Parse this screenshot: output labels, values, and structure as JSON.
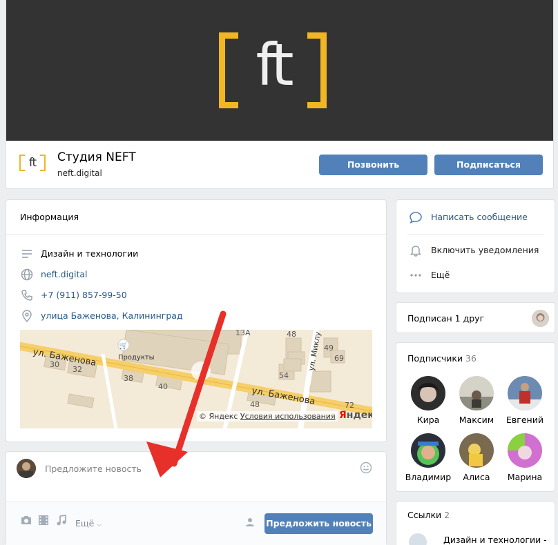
{
  "header": {
    "logo_text": "ft",
    "group_name": "Студия NEFT",
    "group_link": "neft.digital",
    "call_button": "Позвонить",
    "subscribe_button": "Подписаться"
  },
  "info": {
    "title": "Информация",
    "rows": [
      {
        "icon": "list-icon",
        "text": "Дизайн и технологии",
        "link": false
      },
      {
        "icon": "globe-icon",
        "text": "neft.digital",
        "link": true
      },
      {
        "icon": "phone-icon",
        "text": "+7 (911) 857-99-50",
        "link": true
      },
      {
        "icon": "location-pin-icon",
        "text": "улица Баженова, Калининград",
        "link": true
      }
    ],
    "map": {
      "street_label_1": "ул. Баженова",
      "street_label_2": "ул. Баженова",
      "street_label_3": "ул. Миклу",
      "shop_label": "Продукты",
      "house_numbers": [
        "13А",
        "48",
        "49",
        "69",
        "30",
        "32",
        "38",
        "40",
        "54",
        "48",
        "72"
      ],
      "copyright": "© Яндекс",
      "terms_link": "Условия использования",
      "brand_first": "Я",
      "brand_rest": "ндекс"
    }
  },
  "post": {
    "placeholder": "Предложите новость",
    "more_label": "Ещё",
    "suggest_button": "Предложить новость"
  },
  "actions": {
    "message": "Написать сообщение",
    "notifications": "Включить уведомления",
    "more": "Ещё"
  },
  "friend": {
    "text": "Подписан 1 друг"
  },
  "subscribers": {
    "title": "Подписчики",
    "count": "36",
    "people": [
      {
        "name": "Кира",
        "color": "#3b3b3b"
      },
      {
        "name": "Максим",
        "color": "#7a7a6a"
      },
      {
        "name": "Евгений",
        "color": "#8a3a2a"
      },
      {
        "name": "Владимир",
        "color": "#4aa84a"
      },
      {
        "name": "Алиса",
        "color": "#b09040"
      },
      {
        "name": "Марина",
        "color": "#c070c0"
      }
    ]
  },
  "links": {
    "title": "Ссылки",
    "count": "2",
    "first_link": "Дизайн и технологии -"
  },
  "colors": {
    "accent": "#5181b8",
    "brand_yellow": "#f0b623",
    "cover_bg": "#333333",
    "link": "#2a5885",
    "arrow": "#e8302a"
  }
}
